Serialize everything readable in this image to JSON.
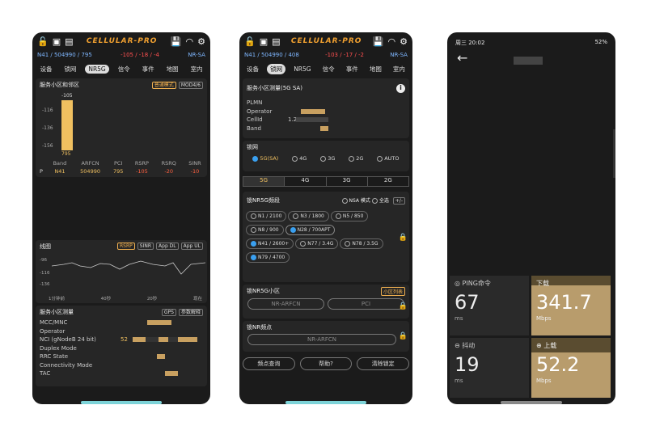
{
  "app": {
    "title": "CELLULAR-PRO"
  },
  "status": {
    "band_info": "N41 / 504990 / 795",
    "signal": "-105 / -18 / -4",
    "mode": "NR-SA"
  },
  "status2": {
    "band_info": "N41 / 504990 / 408",
    "signal": "-103 / -17 / -2",
    "mode": "NR-SA"
  },
  "tabs": [
    "设备",
    "锁网",
    "NR5G",
    "信令",
    "事件",
    "地图",
    "室内"
  ],
  "p1": {
    "serving_title": "服务小区和邻区",
    "chip1": "普通模式",
    "chip2": "MOD4/6",
    "bar_top": "-105",
    "bar_bottom": "795",
    "yt": [
      "-116",
      "-136",
      "-156"
    ],
    "cols": [
      "Band",
      "ARFCN",
      "PCI",
      "RSRP",
      "RSRQ",
      "SINR"
    ],
    "row": {
      "p": "P",
      "band": "N41",
      "arfcn": "504990",
      "pci": "795",
      "rsrp": "-105",
      "rsrq": "-20",
      "sinr": "-10"
    },
    "line_title": "线图",
    "lchips": [
      "RSRP",
      "SINR",
      "App DL",
      "App UL"
    ],
    "ly": [
      "-96",
      "-116",
      "-136"
    ],
    "lx": [
      "1分钟前",
      "40秒",
      "20秒",
      "现在"
    ],
    "meas_title": "服务小区测量",
    "gps": "GPS",
    "params": "参数解释",
    "kv": [
      "MCC/MNC",
      "Operator",
      "NCI (gNodeB 24 bit)",
      "Duplex Mode",
      "RRC State",
      "Connectivity Mode",
      "TAC"
    ],
    "nci_prefix": "52"
  },
  "p2": {
    "meas_title": "服务小区测量(5G SA)",
    "kv": [
      "PLMN",
      "Operator",
      "CellId",
      "Band"
    ],
    "cellid_prefix": "1.2",
    "lock_title": "锁网",
    "net_opts": [
      "5G(SA)",
      "4G",
      "3G",
      "2G",
      "AUTO"
    ],
    "seg": [
      "5G",
      "4G",
      "3G",
      "2G"
    ],
    "nr_title": "锁NR5G频段",
    "nsa": "NSA 模式",
    "all": "全选",
    "pm": "+/-",
    "bands": [
      "N1 / 2100",
      "N3 / 1800",
      "N5 / 850",
      "N8 / 900",
      "N28 / 700APT",
      "N41 / 2600+",
      "N77 / 3.4G",
      "N78 / 3.5G",
      "N79 / 4700"
    ],
    "cell_title": "锁NR5G小区",
    "cell_list": "小区列表",
    "arfcn_ph": "NR-ARFCN",
    "pci_ph": "PCI",
    "freq_title": "锁NR频点",
    "freq_ph": "NR-ARFCN",
    "b1": "频点查询",
    "b2": "帮助?",
    "b3": "清除锁定"
  },
  "p3": {
    "time": "周三 20:02",
    "battery": "52%",
    "ping_label": "PING命令",
    "ping": "67",
    "ping_unit": "ms",
    "dl_label": "下载",
    "dl": "341.7",
    "dl_unit": "Mbps",
    "jit_label": "抖动",
    "jit": "19",
    "jit_unit": "ms",
    "ul_label": "上载",
    "ul": "52.2",
    "ul_unit": "Mbps"
  },
  "colors": {
    "bar": "#f0c060",
    "accent": "#3aa0f0",
    "gold": "#c8a878"
  }
}
